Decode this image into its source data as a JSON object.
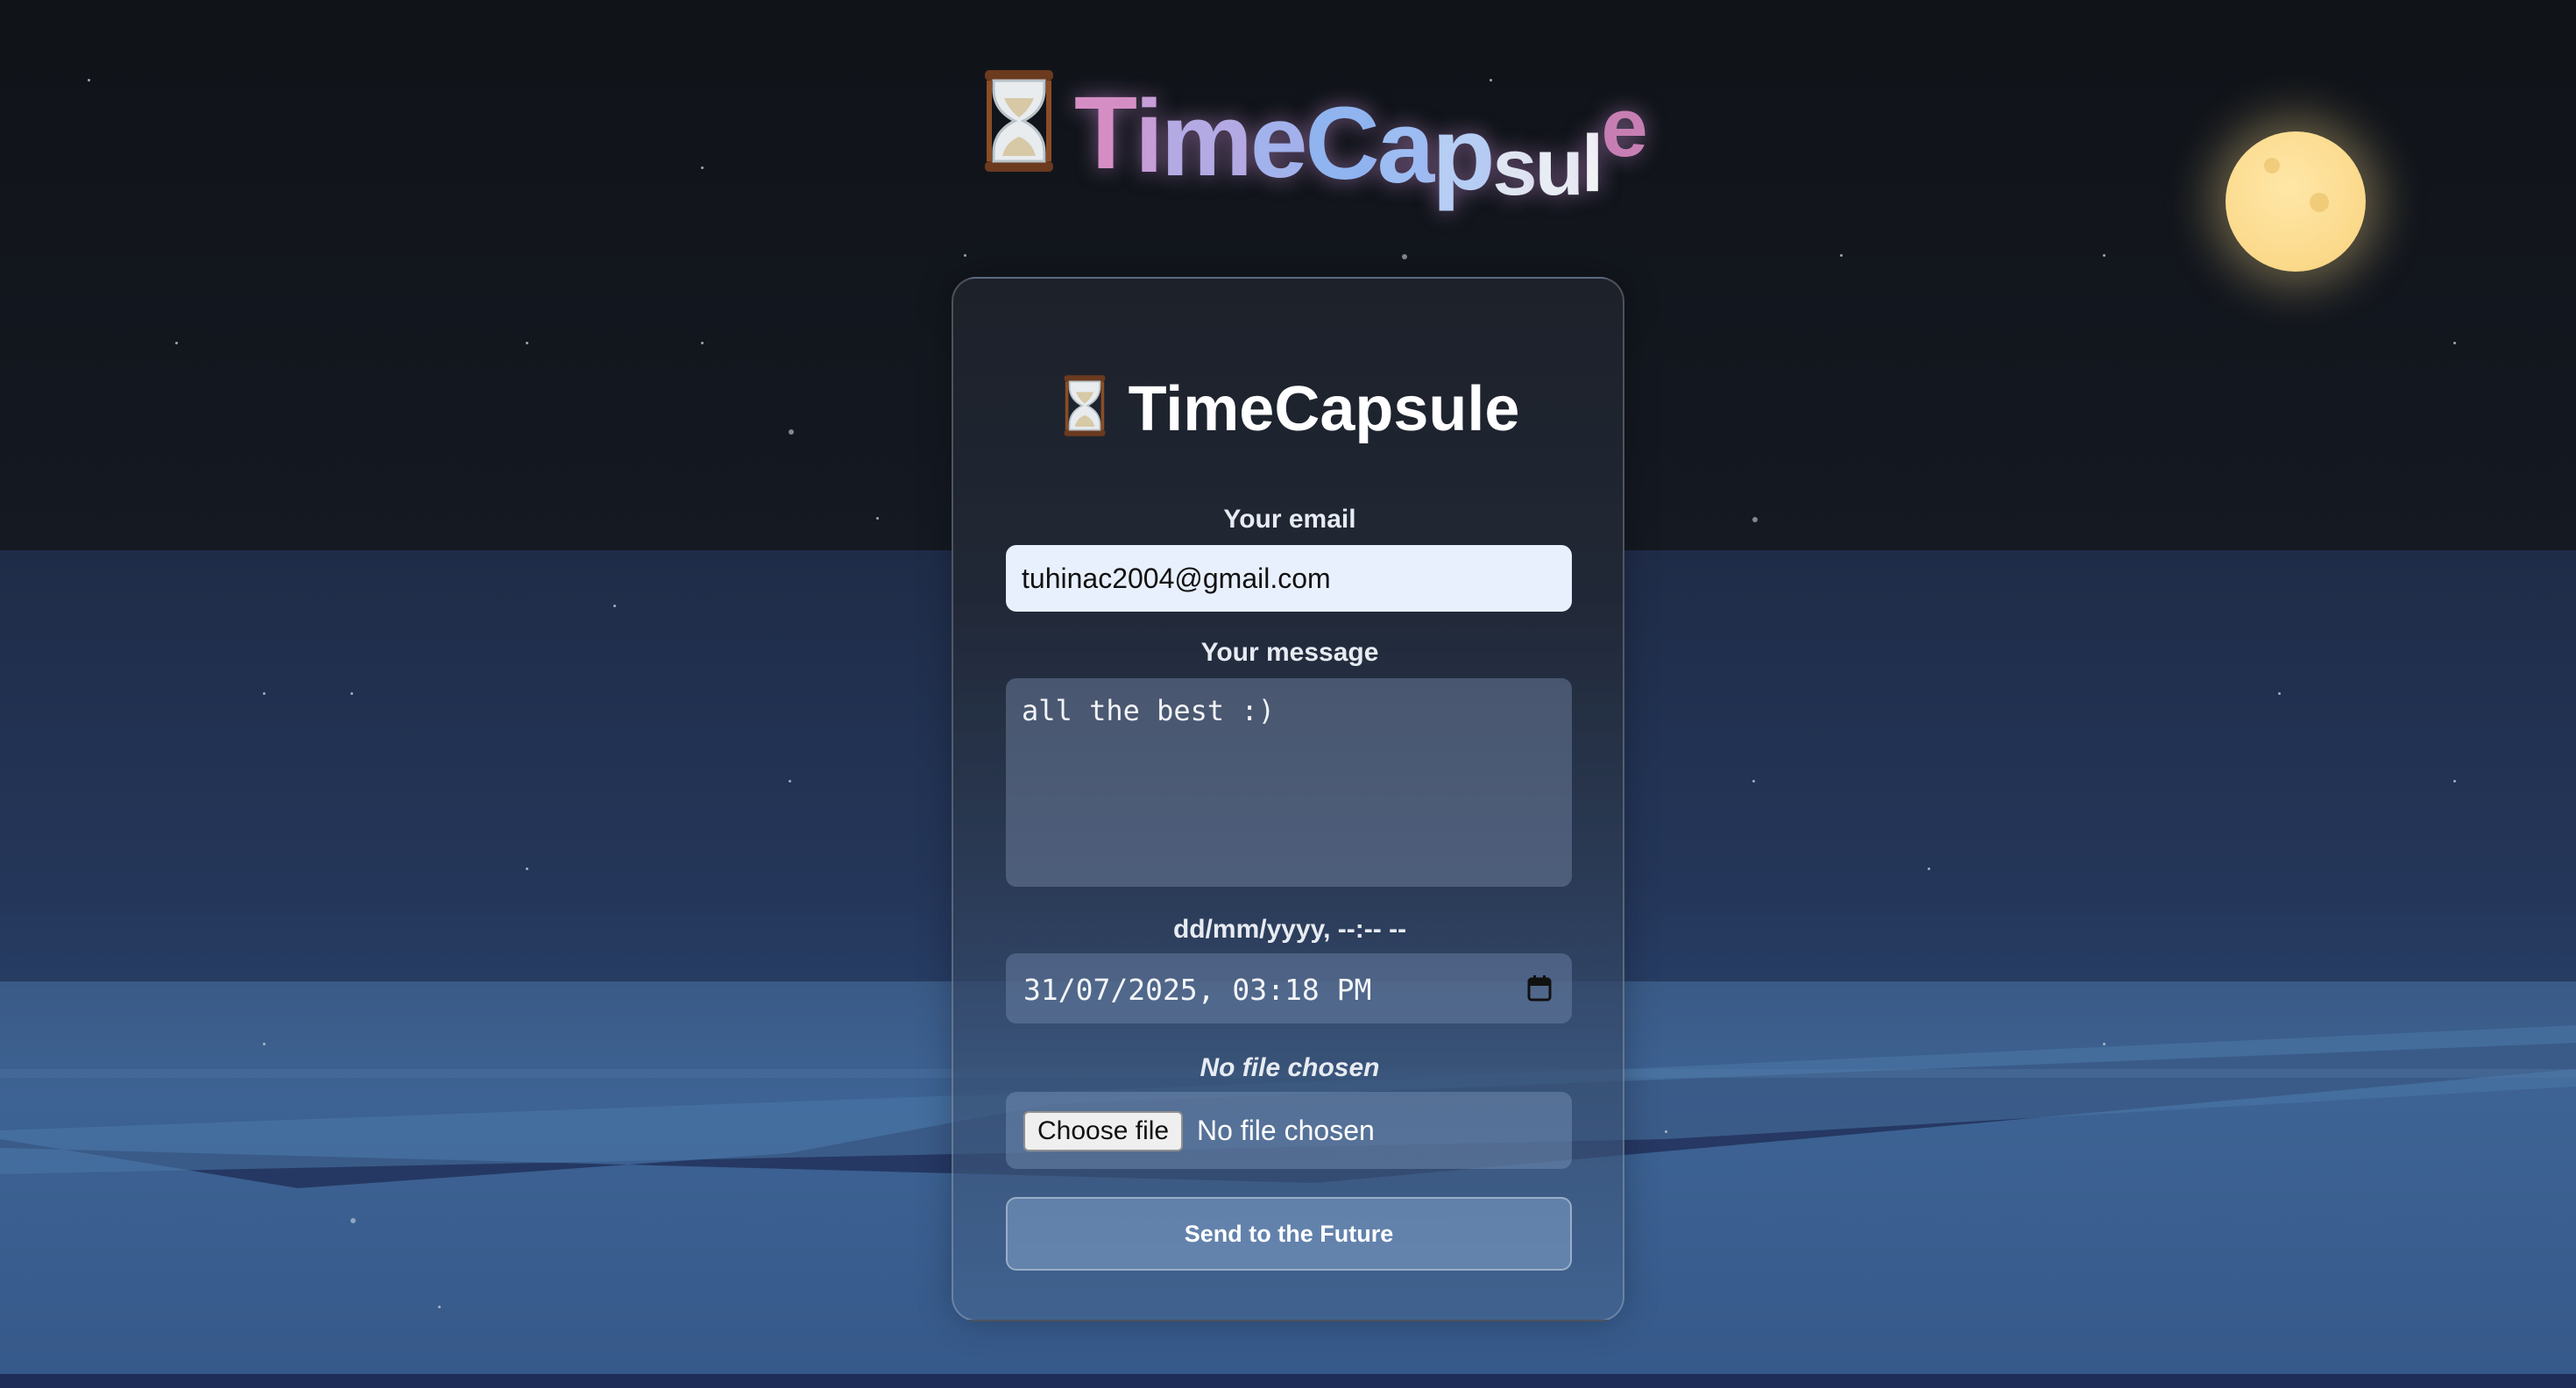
{
  "logo": {
    "letters": [
      "T",
      "i",
      "m",
      "e",
      "C",
      "a",
      "p",
      "s",
      "u",
      "l",
      "e"
    ],
    "icon": "hourglass-icon"
  },
  "form": {
    "title": "TimeCapsule",
    "title_icon": "hourglass-icon",
    "email_label": "Your email",
    "email_value": "tuhinac2004@gmail.com",
    "message_label": "Your message",
    "message_value": "all the best :)",
    "datetime_label": "dd/mm/yyyy, --:-- --",
    "datetime_value": "31/07/2025, 03:18 PM",
    "datetime_icon": "calendar-icon",
    "file_label": "No file chosen",
    "file_button": "Choose file",
    "file_status": "No file chosen",
    "submit_label": "Send to the Future"
  },
  "colors": {
    "moon": "#fbd98a",
    "logo_pink": "#d58ec4",
    "logo_blue": "#8fb4f0",
    "input_bg": "#e8f0fe"
  }
}
